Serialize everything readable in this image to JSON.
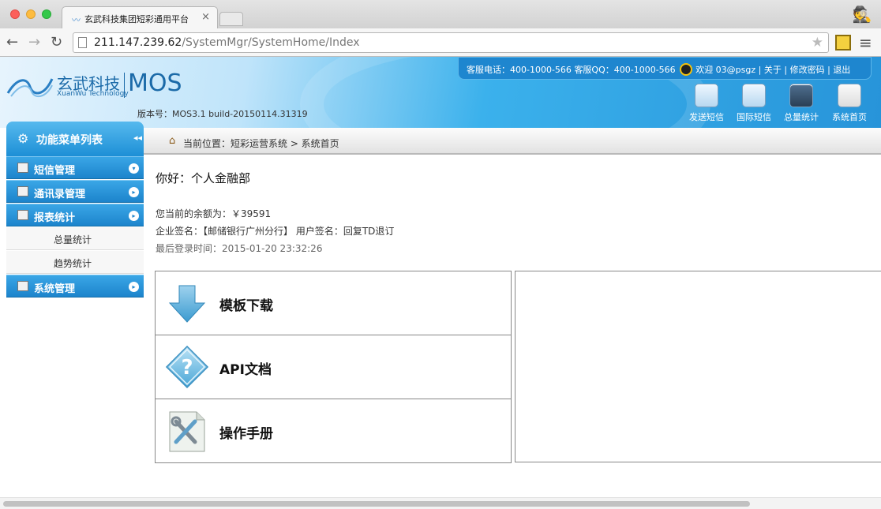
{
  "browser": {
    "tab_title": "玄武科技集团短彩通用平台",
    "tab_close": "×",
    "url_host": "211.147.239.62",
    "url_path": "/SystemMgr/SystemHome/Index"
  },
  "header": {
    "logo_cn": "玄武科技",
    "logo_en": "XuanWu Technology",
    "logo_mos": "MOS",
    "version": "版本号：MOS3.1 build-20150114.31319",
    "service_phone": "客服电话：400-1000-566",
    "service_qq": "客服QQ：400-1000-566",
    "welcome": "欢迎 03@psgz",
    "sep1": "|",
    "about": "关于",
    "sep2": "|",
    "change_password": "修改密码",
    "sep3": "|",
    "logout": "退出",
    "quick_links": [
      "发送短信",
      "国际短信",
      "总量统计",
      "系统首页"
    ]
  },
  "sidebar": {
    "title": "功能菜单列表",
    "collapse": "◂◂",
    "items": [
      {
        "label": "短信管理",
        "arrow": "▾"
      },
      {
        "label": "通讯录管理",
        "arrow": "▸"
      },
      {
        "label": "报表统计",
        "arrow": "▸"
      },
      {
        "label": "系统管理",
        "arrow": "▸"
      }
    ],
    "subitems": [
      "总量统计",
      "趋势统计"
    ]
  },
  "breadcrumb": {
    "text": "当前位置：短彩运营系统 > 系统首页"
  },
  "main": {
    "greeting": "你好：个人金融部",
    "balance": "您当前的余额为：￥39591",
    "signatures": "企业签名：【邮储银行广州分行】 用户签名：回复TD退订",
    "last_login": "最后登录时间：2015-01-20 23:32:26",
    "panel_items": [
      "模板下载",
      "API文档",
      "操作手册"
    ]
  },
  "icons": {
    "sidebar_head": "gear-icon",
    "download": "arrow-down-icon",
    "api": "question-icon",
    "manual": "tools-icon"
  },
  "colors": {
    "brand_blue": "#1d8fd6",
    "header_light": "#e7f4fd",
    "header_dark": "#2794d9"
  }
}
